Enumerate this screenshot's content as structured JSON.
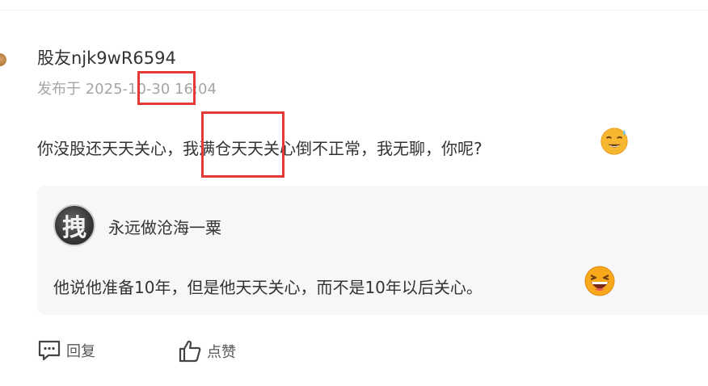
{
  "comment": {
    "username": "股友njk9wR6594",
    "timestamp": "发布于 2025-10-30 16:04",
    "text": "你没股还天天关心，我满仓天天关心倒不正常，我无聊，你呢?",
    "emoji": "sweat-smile-emoji"
  },
  "quote": {
    "avatar_char": "拽",
    "author": "永远做沧海一粟",
    "text": "他说他准备10年，但是他天天关心，而不是10年以后关心。",
    "emoji": "laughing-emoji"
  },
  "actions": {
    "reply_label": "回复",
    "like_label": "点赞",
    "reply_icon": "comment-icon",
    "like_icon": "thumbs-up-icon"
  },
  "colors": {
    "highlight": "#e53935",
    "quote_background": "#f6f7f9",
    "timestamp": "#a6a6a6"
  }
}
